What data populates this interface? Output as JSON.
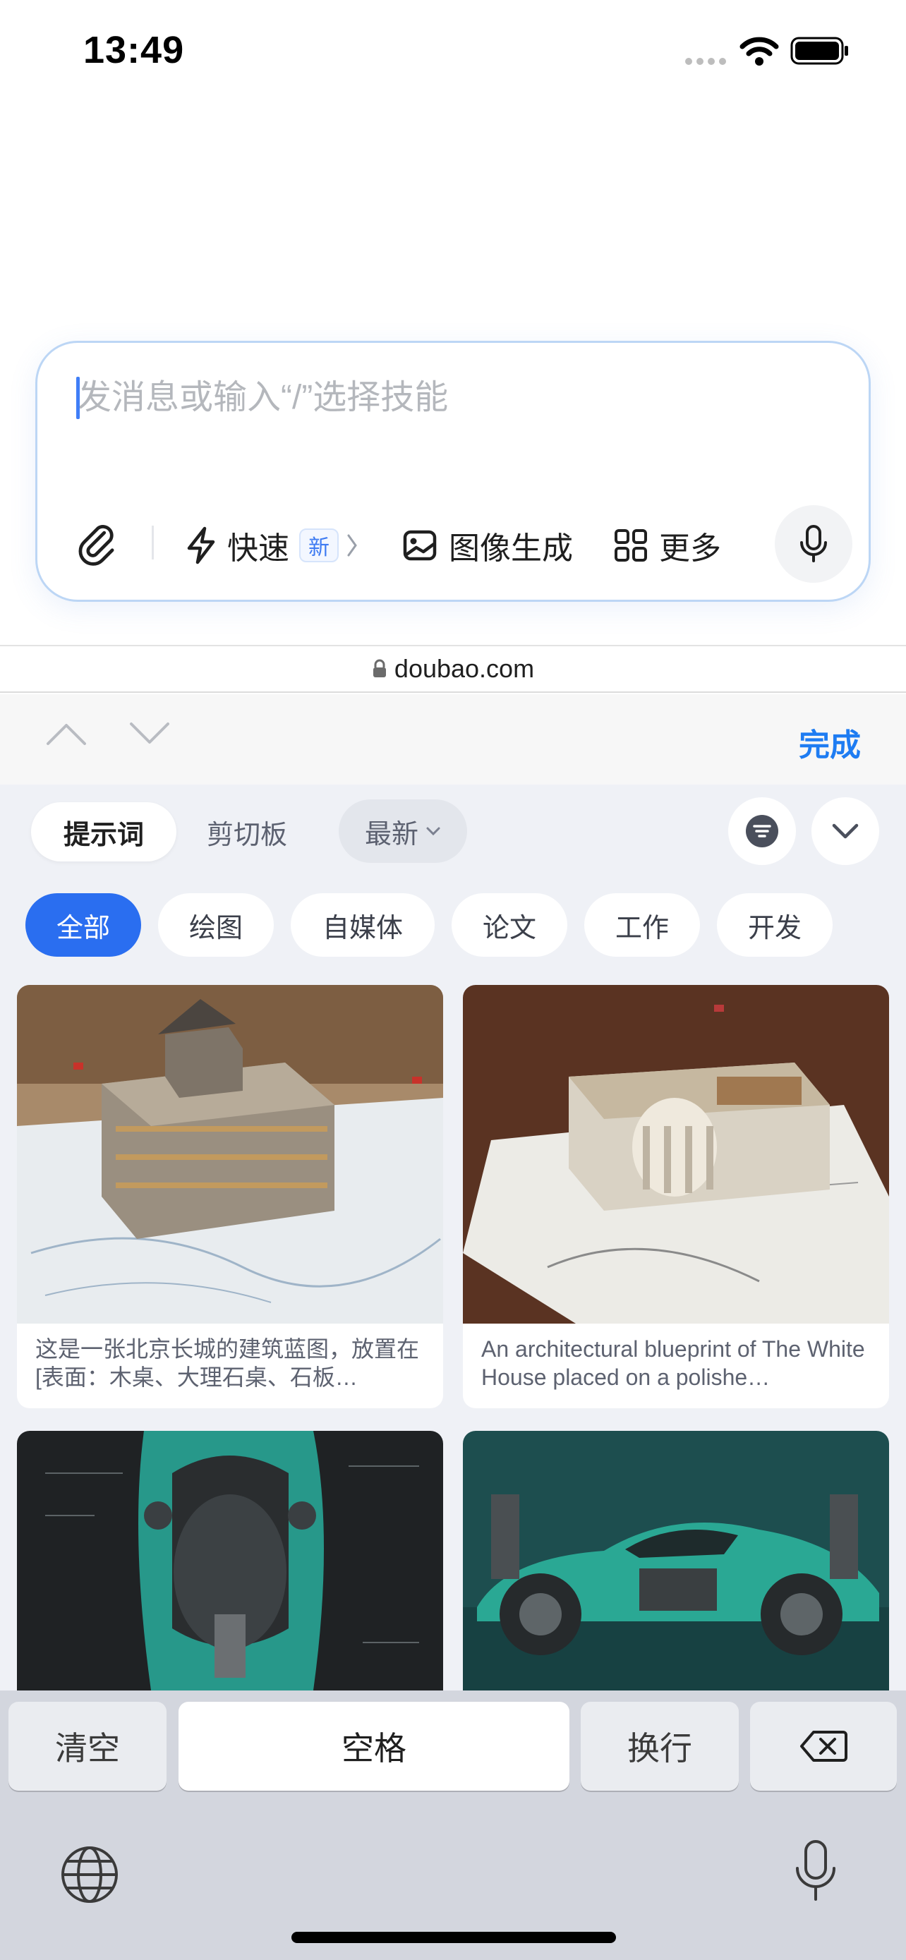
{
  "status_bar": {
    "time": "13:49"
  },
  "composer": {
    "placeholder": "发消息或输入“/”选择技能",
    "quick_label": "快速",
    "new_badge": "新",
    "image_gen_label": "图像生成",
    "more_label": "更多"
  },
  "url_bar": {
    "domain": "doubao.com"
  },
  "accessory": {
    "done_label": "完成"
  },
  "panel": {
    "tabs": [
      {
        "label": "提示词"
      },
      {
        "label": "剪切板"
      }
    ],
    "sort_label": "最新",
    "categories": [
      {
        "label": "全部"
      },
      {
        "label": "绘图"
      },
      {
        "label": "自媒体"
      },
      {
        "label": "论文"
      },
      {
        "label": "工作"
      },
      {
        "label": "开发"
      }
    ],
    "cards": [
      {
        "caption": "这是一张北京长城的建筑蓝图，放置在[表面：木桌、大理石桌、石板…"
      },
      {
        "caption": "An architectural blueprint of The White House placed on a polishe…"
      },
      {
        "caption": ""
      },
      {
        "caption": ""
      }
    ]
  },
  "keyboard": {
    "clear_label": "清空",
    "space_label": "空格",
    "enter_label": "换行"
  },
  "colors": {
    "accent": "#2a6ef0",
    "done": "#1e7cf2",
    "panel_bg": "#eff1f6"
  }
}
